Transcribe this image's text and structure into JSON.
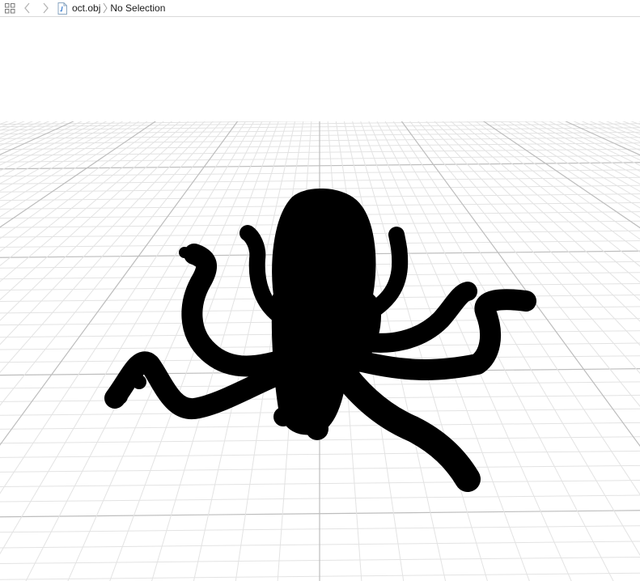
{
  "jump_bar": {
    "file_name": "oct.obj",
    "selection_label": "No Selection",
    "icons": {
      "grid": "related-items-grid-icon",
      "back": "chevron-left-icon",
      "forward": "chevron-right-icon",
      "file": "obj-file-icon",
      "separator": "breadcrumb-chevron-icon"
    }
  },
  "scene_viewer": {
    "model": "octopus-model",
    "background_color": "#ffffff",
    "grid_color": "#e3e3e3",
    "model_color": "#000000"
  }
}
